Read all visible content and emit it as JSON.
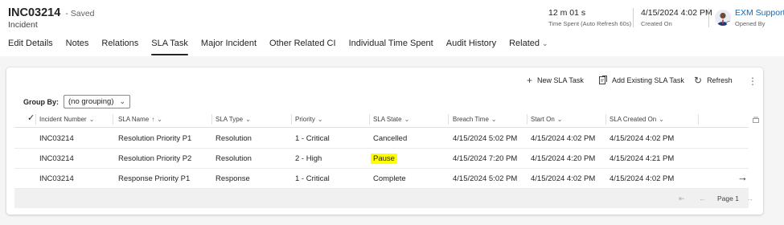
{
  "header": {
    "record_id": "INC03214",
    "saved_status": "- Saved",
    "record_type": "Incident",
    "time_spent_value": "12 m 01 s",
    "time_spent_label": "Time Spent (Auto Refresh 60s)",
    "created_on_value": "4/15/2024 4:02 PM",
    "created_on_label": "Created On",
    "owner_name": "EXM Support",
    "owner_label": "Opened By"
  },
  "tabs": [
    {
      "label": "Edit Details"
    },
    {
      "label": "Notes"
    },
    {
      "label": "Relations"
    },
    {
      "label": "SLA Task",
      "active": true
    },
    {
      "label": "Major Incident"
    },
    {
      "label": "Other Related CI"
    },
    {
      "label": "Individual Time Spent"
    },
    {
      "label": "Audit History"
    },
    {
      "label": "Related"
    }
  ],
  "commands": {
    "new_sla": "New SLA Task",
    "add_existing": "Add Existing SLA Task",
    "refresh": "Refresh"
  },
  "group_by": {
    "label": "Group By:",
    "value": "(no grouping)"
  },
  "grid": {
    "columns": [
      "Incident Number",
      "SLA Name",
      "SLA Type",
      "Priority",
      "SLA State",
      "Breach Time",
      "Start On",
      "SLA Created On"
    ],
    "rows": [
      [
        "INC03214",
        "Resolution Priority P1",
        "Resolution",
        "1 - Critical",
        "Cancelled",
        "4/15/2024 5:02 PM",
        "4/15/2024 4:02 PM",
        "4/15/2024 4:02 PM"
      ],
      [
        "INC03214",
        "Resolution Priority P2",
        "Resolution",
        "2 - High",
        "Pause",
        "4/15/2024 7:20 PM",
        "4/15/2024 4:20 PM",
        "4/15/2024 4:21 PM"
      ],
      [
        "INC03214",
        "Response Priority P1",
        "Response",
        "1 - Critical",
        "Complete",
        "4/15/2024 5:02 PM",
        "4/15/2024 4:02 PM",
        "4/15/2024 4:02 PM"
      ]
    ],
    "highlighted_value": "Pause",
    "highlight_color": "#ffff00"
  },
  "pagination": {
    "label": "Page 1"
  },
  "colors": {
    "accent": "#0f6cbd",
    "content_bg": "#f5f5f5"
  }
}
